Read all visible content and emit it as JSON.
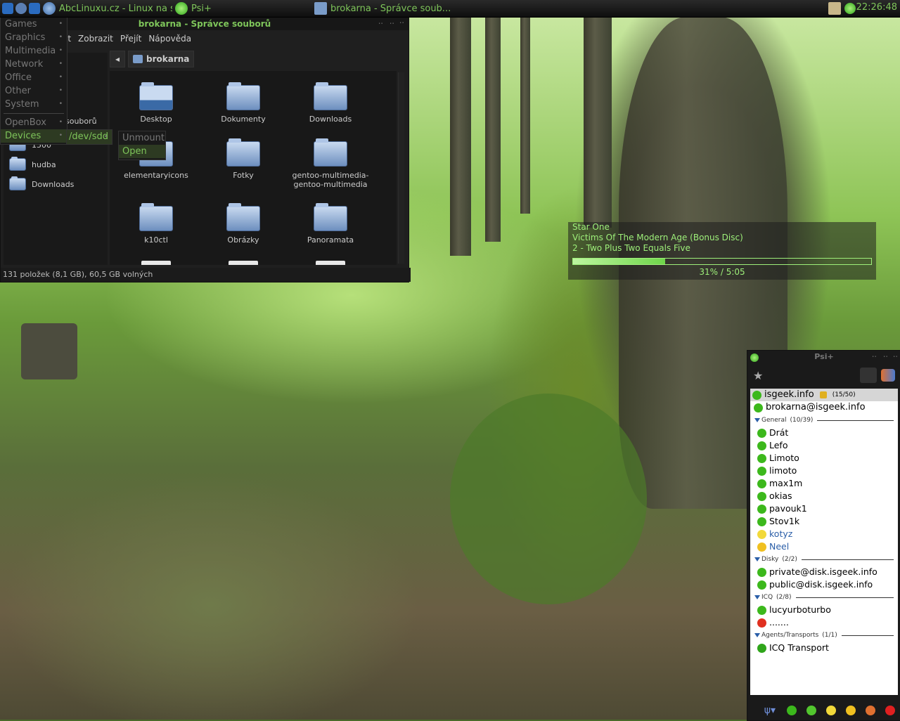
{
  "top_panel": {
    "tasks": [
      {
        "label": "AbcLinuxu.cz - Linux na s...",
        "icon": "browser-icon"
      },
      {
        "label": "Psi+",
        "icon": "psi-online-icon"
      },
      {
        "label": "brokarna - Správce soub...",
        "icon": "home-folder-icon"
      }
    ],
    "clock": "22:26:48"
  },
  "file_manager": {
    "title": "brokarna - Správce souborů",
    "menu": [
      "it",
      "Zobrazit",
      "Přejít",
      "Nápověda"
    ],
    "path_button": "brokarna",
    "sidebar": {
      "partial_label": "souborů",
      "items": [
        "1500",
        "hudba",
        "Downloads"
      ]
    },
    "items": [
      {
        "label": "Desktop"
      },
      {
        "label": "Dokumenty"
      },
      {
        "label": "Downloads"
      },
      {
        "label": "elementaryicons"
      },
      {
        "label": "Fotky"
      },
      {
        "label": "gentoo-multimedia-gentoo-multimedia"
      },
      {
        "label": "k10ctl"
      },
      {
        "label": "Obrázky"
      },
      {
        "label": "Panoramata"
      }
    ],
    "status": "131 položek (8,1 GB), 60,5 GB volných"
  },
  "openbox_menu": {
    "items": [
      "Games",
      "Graphics",
      "Multimedia",
      "Network",
      "Office",
      "Other",
      "System"
    ],
    "items2": [
      "OpenBox",
      "Devices"
    ],
    "submenu": "/dev/sdd",
    "submenu2": [
      "Unmount",
      "Open"
    ]
  },
  "osd": {
    "artist": "Star One",
    "album": "Victims Of The Modern Age (Bonus Disc)",
    "track": "2 - Two Plus Two Equals Five",
    "progress": 0.31,
    "time": "31% / 5:05"
  },
  "psi": {
    "title": "Psi+",
    "account": {
      "label": "isgeek.info",
      "count": "(15/50)"
    },
    "self": "brokarna@isgeek.info",
    "groups": [
      {
        "name": "General",
        "count": "(10/39)",
        "contacts": [
          {
            "name": "Drát",
            "status": "online"
          },
          {
            "name": "Lefo",
            "status": "online"
          },
          {
            "name": "Limoto",
            "status": "online"
          },
          {
            "name": "limoto",
            "status": "online"
          },
          {
            "name": "max1m",
            "status": "online"
          },
          {
            "name": "okias",
            "status": "online"
          },
          {
            "name": "pavouk1",
            "status": "online"
          },
          {
            "name": "Stov1k",
            "status": "online"
          },
          {
            "name": "kotyz",
            "status": "away"
          },
          {
            "name": "Neel",
            "status": "xa"
          }
        ]
      },
      {
        "name": "Disky",
        "count": "(2/2)",
        "contacts": [
          {
            "name": "private@disk.isgeek.info",
            "status": "online"
          },
          {
            "name": "public@disk.isgeek.info",
            "status": "online"
          }
        ]
      },
      {
        "name": "ICQ",
        "count": "(2/8)",
        "contacts": [
          {
            "name": "lucyurboturbo",
            "status": "online"
          },
          {
            "name": ".......",
            "status": "dnd"
          }
        ]
      },
      {
        "name": "Agents/Transports",
        "count": "(1/1)",
        "contacts": [
          {
            "name": "ICQ Transport",
            "status": "transport"
          }
        ]
      }
    ],
    "colors": {
      "online": "#3cb81c",
      "away": "#f2d93a",
      "xa": "#f0c020",
      "dnd": "#e03020",
      "transport": "#2fa51a",
      "link": "#2a5ea8"
    }
  }
}
